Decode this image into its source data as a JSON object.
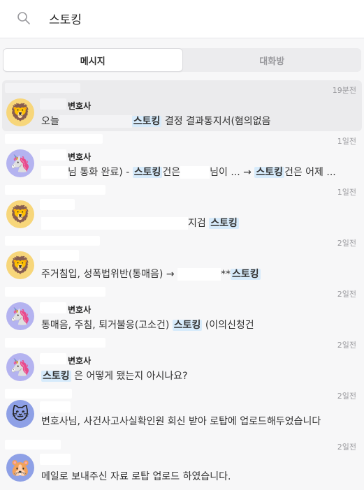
{
  "search": {
    "query": "스토킹"
  },
  "tabs": [
    {
      "label": "메시지"
    },
    {
      "label": "대화방"
    }
  ],
  "results": [
    {
      "time": "19분전",
      "name": "변호사",
      "avatar": "lion-icon",
      "pre": "오늘",
      "hl": "스토킹",
      "post": " 결정 결과통지서(혐의없음"
    },
    {
      "time": "1일전",
      "name": "변호사",
      "avatar": "unicorn-icon",
      "pre": "님 통화 완료) - ",
      "hl": "스토킹",
      "mid": "건은",
      "mid2": "님이 ... → ",
      "hl2": "스토킹",
      "post": "건은 어제 ..."
    },
    {
      "time": "1일전",
      "name": "",
      "avatar": "lion-icon",
      "pre": "지검 ",
      "hl": "스토킹",
      "post": ""
    },
    {
      "time": "2일전",
      "name": "",
      "avatar": "lion-icon",
      "pre": "주거침입, 성폭법위반(통매음) → ",
      "mid": "**",
      "hl": "스토킹",
      "post": ""
    },
    {
      "time": "2일전",
      "name": "변호사",
      "avatar": "unicorn-icon",
      "pre": "통매음, 주침, 퇴거불응(고소건) ",
      "hl": "스토킹",
      "post": " (이의신청건"
    },
    {
      "time": "2일전",
      "name": "변호사",
      "avatar": "unicorn-icon",
      "pre": "",
      "hl": "스토킹",
      "post": " 은 어떻게 됐는지 아시나요?"
    },
    {
      "time": "2일전",
      "name": "",
      "avatar": "cat-icon",
      "pre": "변호사님, 사건사고사실확인원 회신 받아 로탑에 업로드해두었습니다",
      "hl": "",
      "post": ""
    },
    {
      "time": "2일전",
      "name": "",
      "avatar": "hamster-icon",
      "pre": "메일로 보내주신 자료 로탑 업로드 하였습니다.",
      "hl": "",
      "post": ""
    }
  ]
}
